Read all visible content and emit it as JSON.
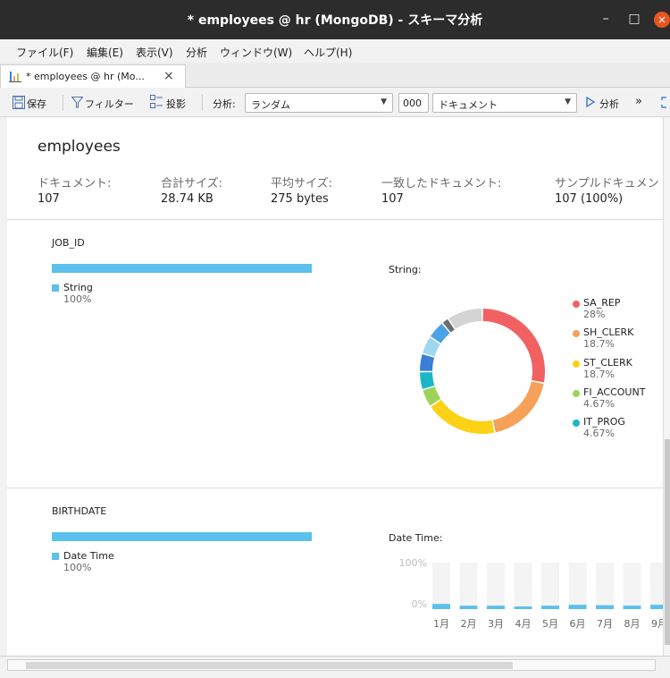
{
  "window": {
    "title": "* employees @ hr (MongoDB) - スキーマ分析",
    "minimize": "–",
    "maximize": "□",
    "close": "×"
  },
  "menu": [
    "ファイル(F)",
    "編集(E)",
    "表示(V)",
    "分析",
    "ウィンドウ(W)",
    "ヘルプ(H)"
  ],
  "tab": {
    "label": "* employees @ hr (Mo...",
    "close": "×"
  },
  "toolbar": {
    "save": "保存",
    "filter": "フィルター",
    "projection": "投影",
    "analysis_label": "分析:",
    "mode_value": "ランダム",
    "count_value": "000",
    "unit_value": "ドキュメント",
    "run": "分析",
    "more": "»"
  },
  "summary": {
    "collection": "employees",
    "stats": [
      {
        "label": "ドキュメント:",
        "value": "107"
      },
      {
        "label": "合計サイズ:",
        "value": "28.74 KB"
      },
      {
        "label": "平均サイズ:",
        "value": "275 bytes"
      },
      {
        "label": "一致したドキュメント:",
        "value": "107"
      },
      {
        "label": "サンプルドキュメン",
        "value": "107 (100%)"
      }
    ]
  },
  "fields": [
    {
      "name": "JOB_ID",
      "type_label": "String",
      "type_percent": "100%",
      "chart_title": "String:",
      "legend": [
        {
          "label": "SA_REP",
          "percent": "28%",
          "color": "#f16161"
        },
        {
          "label": "SH_CLERK",
          "percent": "18.7%",
          "color": "#f5a15a"
        },
        {
          "label": "ST_CLERK",
          "percent": "18.7%",
          "color": "#fcd116"
        },
        {
          "label": "FI_ACCOUNT",
          "percent": "4.67%",
          "color": "#9ed35a"
        },
        {
          "label": "IT_PROG",
          "percent": "4.67%",
          "color": "#1ab8c6"
        }
      ]
    },
    {
      "name": "BIRTHDATE",
      "type_label": "Date Time",
      "type_percent": "100%",
      "chart_title": "Date Time:"
    }
  ],
  "chart_data": [
    {
      "type": "pie",
      "title": "String:",
      "series": [
        {
          "name": "SA_REP",
          "value": 28,
          "color": "#f16161"
        },
        {
          "name": "SH_CLERK",
          "value": 18.7,
          "color": "#f5a15a"
        },
        {
          "name": "ST_CLERK",
          "value": 18.7,
          "color": "#fcd116"
        },
        {
          "name": "FI_ACCOUNT",
          "value": 4.67,
          "color": "#9ed35a"
        },
        {
          "name": "IT_PROG",
          "value": 4.67,
          "color": "#1ab8c6"
        },
        {
          "value": 4.67,
          "color": "#3a7fd5"
        },
        {
          "value": 4.67,
          "color": "#9fd6f0"
        },
        {
          "value": 4.67,
          "color": "#4aa3e6"
        },
        {
          "value": 1.87,
          "color": "#6e6e6e"
        },
        {
          "value": 9.19,
          "color": "#d4d4d4"
        }
      ]
    },
    {
      "type": "bar",
      "title": "Date Time:",
      "categories": [
        "1月",
        "2月",
        "3月",
        "4月",
        "5月",
        "6月",
        "7月",
        "8月",
        "9月"
      ],
      "values": [
        11.2,
        7.5,
        7.5,
        4.7,
        7.5,
        9.3,
        8.4,
        7.5,
        9.3
      ],
      "ylim": [
        0,
        100
      ],
      "yticks": [
        "100%",
        "0%"
      ]
    }
  ]
}
